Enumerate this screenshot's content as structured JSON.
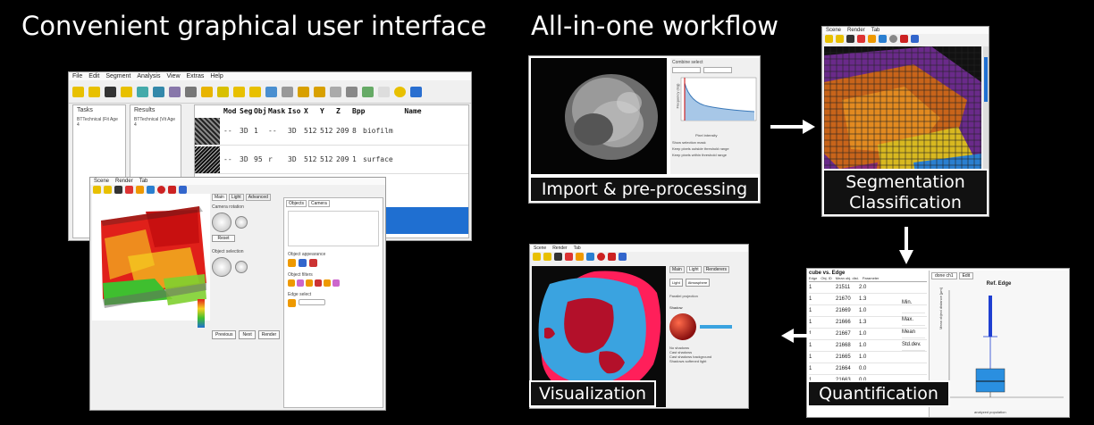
{
  "headings": {
    "left": "Convenient graphical user interface",
    "right": "All-in-one workflow"
  },
  "labels": {
    "import": "Import & pre-processing",
    "segmentation_line1": "Segmentation",
    "segmentation_line2": "Classification",
    "quantification": "Quantification",
    "visualization": "Visualization"
  },
  "main_window": {
    "menu": [
      "File",
      "Edit",
      "Segment",
      "Analysis",
      "View",
      "Extras",
      "Help"
    ],
    "tasks_title": "Tasks",
    "tasks_item": "BTTechnical (Fit Age 4",
    "results_title": "Results",
    "results_item": "BTTechnical (Vit Age 4",
    "columns": [
      "Mod",
      "Seg",
      "Obj",
      "Mask",
      "Iso",
      "X",
      "Y",
      "Z",
      "Bpp",
      "Name"
    ],
    "rows": [
      [
        "--",
        "3D",
        "1",
        "--",
        "3D",
        "512",
        "512",
        "209",
        "8",
        "biofilm"
      ],
      [
        "--",
        "3D",
        "95",
        "r",
        "3D",
        "512",
        "512",
        "209",
        "1",
        "surface"
      ]
    ]
  },
  "render_window": {
    "menu": [
      "Scene",
      "Render",
      "Tab"
    ],
    "tabs": [
      "Main",
      "Light",
      "Advanced"
    ],
    "side_tabs": [
      "Objects",
      "Camera"
    ],
    "reset": "Reset",
    "labels": [
      "Camera rotation",
      "Object selection",
      "Object appearance",
      "Object filters",
      "Edge select"
    ],
    "buttons": [
      "Previous",
      "Next",
      "Render"
    ]
  },
  "import_panel": {
    "title": "Combine select",
    "x_label": "Pixel intensity",
    "y_label": "Frequency (log)",
    "options": [
      "Show selection mask",
      "Keep pixels outside threshold range",
      "Keep pixels within threshold range"
    ]
  },
  "quant_panel": {
    "header": "cube vs. Edge",
    "tabs": [
      "done ch1",
      "Edit"
    ],
    "col_headers": [
      "Edge",
      "Obj. ID",
      "Mean obj. dist.",
      "Parameter"
    ],
    "rows": [
      [
        "1",
        "21511",
        "2.0"
      ],
      [
        "1",
        "21670",
        "1.3"
      ],
      [
        "1",
        "21669",
        "1.0"
      ],
      [
        "1",
        "21666",
        "1.3"
      ],
      [
        "1",
        "21667",
        "1.0"
      ],
      [
        "1",
        "21668",
        "1.0"
      ],
      [
        "1",
        "21665",
        "1.0"
      ],
      [
        "1",
        "21664",
        "0.0"
      ],
      [
        "1",
        "21663",
        "0.0"
      ]
    ],
    "stats": [
      "Min.",
      "Max.",
      "Mean",
      "Std.dev."
    ],
    "plot_title": "Ref. Edge",
    "plot_xlabel": "analyzed population",
    "plot_ylabel": "Mean object distance [µm]"
  },
  "vis_panel": {
    "menu": [
      "Scene",
      "Render",
      "Tab"
    ],
    "tabs": [
      "Main",
      "Light",
      "Renderers"
    ],
    "sections": [
      "Light",
      "Atmosphere",
      "Shadow"
    ],
    "options": [
      "Parallel projection",
      "No shadows",
      "Cast shadows",
      "Cast shadows background",
      "Shadows softened light"
    ]
  },
  "colors": {
    "background": "#000000",
    "selection_blue": "#1f6fd1",
    "heat_red": "#e0201a",
    "heat_green": "#3fbf2f",
    "vis_blue": "#3aa3e0",
    "vis_red": "#b3102a",
    "vis_magenta": "#ff1f5a"
  }
}
